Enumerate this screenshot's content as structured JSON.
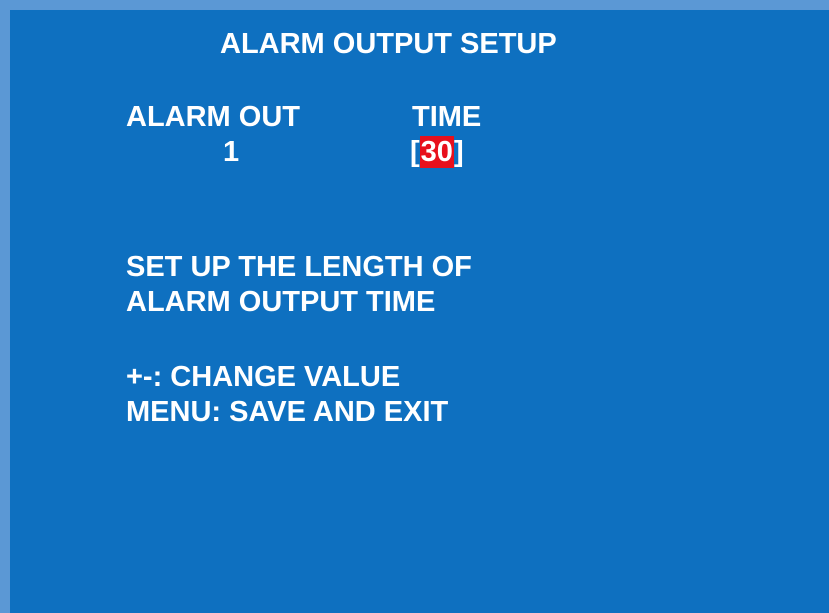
{
  "title": "ALARM OUTPUT SETUP",
  "columns": {
    "alarm_out_header": "ALARM OUT",
    "time_header": "TIME"
  },
  "alarm_out": {
    "number": "1"
  },
  "time": {
    "open_bracket": "[",
    "value": "30",
    "close_bracket": "]"
  },
  "description": {
    "line1": "SET UP THE LENGTH OF",
    "line2": "ALARM OUTPUT TIME"
  },
  "help": {
    "change_value": "+-: CHANGE VALUE",
    "save_exit": "MENU: SAVE AND EXIT"
  },
  "colors": {
    "background": "#0e70c0",
    "border": "#5b98d5",
    "text": "#ffffff",
    "selection": "#e8101c"
  }
}
